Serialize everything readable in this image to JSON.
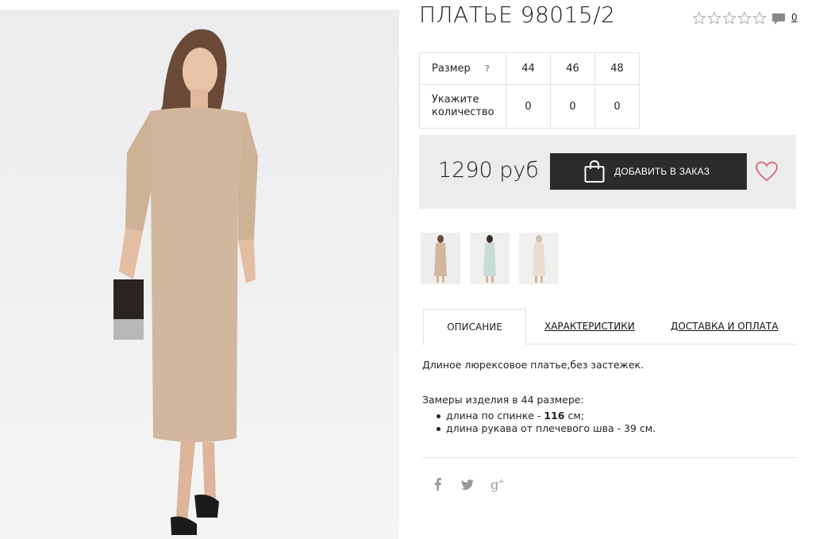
{
  "product": {
    "title": "ПЛАТЬЕ 98015/2",
    "comment_count": "0",
    "rating_stars": 5
  },
  "sizes": {
    "size_label": "Размер",
    "help": "?",
    "qty_label_1": "Укажите",
    "qty_label_2": "количество",
    "options": [
      {
        "size": "44",
        "qty": "0"
      },
      {
        "size": "46",
        "qty": "0"
      },
      {
        "size": "48",
        "qty": "0"
      }
    ]
  },
  "order": {
    "price": "1290 руб",
    "add_button": "ДОБАВИТЬ В ЗАКАЗ"
  },
  "tabs": {
    "description": "ОПИСАНИЕ",
    "specs": "ХАРАКТЕРИСТИКИ",
    "delivery": "ДОСТАВКА И ОПЛАТА"
  },
  "description": {
    "text": "Длиное люрексовое платье,без застежек.",
    "measurements_title": "Замеры изделия в 44 размере:",
    "items": [
      {
        "label": "длина по спинке - ",
        "value": "116",
        "suffix": " см;"
      },
      {
        "label": "длина рукава от плечевого шва - 39 см.",
        "value": "",
        "suffix": ""
      }
    ]
  },
  "colors": {
    "button_bg": "#2b2b2b",
    "price_panel_bg": "#ececec",
    "heart": "#d9707f",
    "dress": "#d2b79c"
  },
  "icons": {
    "social": [
      "facebook-icon",
      "twitter-icon",
      "google-plus-icon"
    ]
  }
}
